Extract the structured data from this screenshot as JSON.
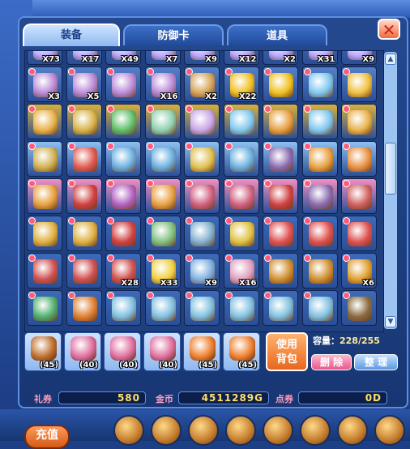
{
  "tabs": [
    {
      "label": "装备",
      "active": true
    },
    {
      "label": "防御卡",
      "active": false
    },
    {
      "label": "道具",
      "active": false
    }
  ],
  "close_icon": "close-x-icon",
  "grid_rows": [
    {
      "items": [
        {
          "color": "#b9a9ff",
          "count": "X73"
        },
        {
          "color": "#b9a9ff",
          "count": "X17"
        },
        {
          "color": "#b9a9ff",
          "count": "X49"
        },
        {
          "color": "#b9a9ff",
          "count": "X7"
        },
        {
          "color": "#b9a9ff",
          "count": "X9"
        },
        {
          "color": "#b9a9ff",
          "count": "X12"
        },
        {
          "color": "#b9a9ff",
          "count": "X2"
        },
        {
          "color": "#b9a9ff",
          "count": "X31"
        },
        {
          "color": "#b9a9ff",
          "count": "X9"
        }
      ]
    },
    {
      "items": [
        {
          "color": "#b98ad8",
          "count": "X3"
        },
        {
          "color": "#b98ad8",
          "count": "X5"
        },
        {
          "color": "#b98ad8",
          "count": ""
        },
        {
          "color": "#b98ad8",
          "count": "X16"
        },
        {
          "color": "#d6a45a",
          "count": "X2"
        },
        {
          "color": "#f0c020",
          "count": "X22"
        },
        {
          "color": "#f0c020",
          "count": ""
        },
        {
          "color": "#7ec8f0",
          "count": ""
        },
        {
          "color": "#f0c040",
          "count": ""
        }
      ]
    },
    {
      "items": [
        {
          "color": "#e8b24a",
          "count": ""
        },
        {
          "color": "#d9b34a",
          "count": ""
        },
        {
          "color": "#5fbf6a",
          "count": ""
        },
        {
          "color": "#8fd0b0",
          "count": ""
        },
        {
          "color": "#c9a6e8",
          "count": ""
        },
        {
          "color": "#7ec8f0",
          "count": ""
        },
        {
          "color": "#e8a040",
          "count": ""
        },
        {
          "color": "#7ec8f0",
          "count": ""
        },
        {
          "color": "#e8b24a",
          "count": ""
        }
      ]
    },
    {
      "items": [
        {
          "color": "#d0b050",
          "count": ""
        },
        {
          "color": "#e05a50",
          "count": ""
        },
        {
          "color": "#6ab0e0",
          "count": ""
        },
        {
          "color": "#6ab0e0",
          "count": ""
        },
        {
          "color": "#e0c050",
          "count": ""
        },
        {
          "color": "#6ab0e0",
          "count": ""
        },
        {
          "color": "#8a6ab0",
          "count": ""
        },
        {
          "color": "#e8a040",
          "count": ""
        },
        {
          "color": "#e89040",
          "count": ""
        }
      ]
    },
    {
      "items": [
        {
          "color": "#e8a040",
          "count": ""
        },
        {
          "color": "#d04040",
          "count": ""
        },
        {
          "color": "#b060c0",
          "count": ""
        },
        {
          "color": "#e8a040",
          "count": ""
        },
        {
          "color": "#d06080",
          "count": ""
        },
        {
          "color": "#d06080",
          "count": ""
        },
        {
          "color": "#d04040",
          "count": ""
        },
        {
          "color": "#8a6ab0",
          "count": ""
        },
        {
          "color": "#d06060",
          "count": ""
        }
      ]
    },
    {
      "items": [
        {
          "color": "#e0b040",
          "count": ""
        },
        {
          "color": "#e0b040",
          "count": ""
        },
        {
          "color": "#d04040",
          "count": ""
        },
        {
          "color": "#80c080",
          "count": ""
        },
        {
          "color": "#80b0d0",
          "count": ""
        },
        {
          "color": "#e0c040",
          "count": ""
        },
        {
          "color": "#e05050",
          "count": ""
        },
        {
          "color": "#e05050",
          "count": ""
        },
        {
          "color": "#e05050",
          "count": ""
        }
      ]
    },
    {
      "items": [
        {
          "color": "#d05050",
          "count": ""
        },
        {
          "color": "#d05050",
          "count": ""
        },
        {
          "color": "#d05050",
          "count": "X28"
        },
        {
          "color": "#f0d040",
          "count": "X33"
        },
        {
          "color": "#80b0e0",
          "count": "X9"
        },
        {
          "color": "#e0a0c0",
          "count": "X16"
        },
        {
          "color": "#d09030",
          "count": ""
        },
        {
          "color": "#d09030",
          "count": ""
        },
        {
          "color": "#e0a030",
          "count": "X6"
        }
      ]
    },
    {
      "items": [
        {
          "color": "#50b070",
          "count": ""
        },
        {
          "color": "#e08030",
          "count": ""
        },
        {
          "color": "#80c0e0",
          "count": ""
        },
        {
          "color": "#80c0e0",
          "count": ""
        },
        {
          "color": "#80c0e0",
          "count": ""
        },
        {
          "color": "#80c0e0",
          "count": ""
        },
        {
          "color": "#80c0e0",
          "count": ""
        },
        {
          "color": "#80c0e0",
          "count": ""
        },
        {
          "color": "#8a6a40",
          "count": ""
        }
      ]
    }
  ],
  "grid_row_tints": [
    "#4a6fb8",
    "#5580c8",
    "#d8b040",
    "#8ec0f0",
    "#f090c0",
    "#3d6ab8",
    "#3d6ab8",
    "#3d6ab8"
  ],
  "equip_slots": [
    {
      "level": "(45)",
      "color": "#c07030"
    },
    {
      "level": "(40)",
      "color": "#e070a0"
    },
    {
      "level": "(40)",
      "color": "#e070a0"
    },
    {
      "level": "(40)",
      "color": "#e070a0"
    },
    {
      "level": "(45)",
      "color": "#f08030"
    },
    {
      "level": "(45)",
      "color": "#f08030"
    }
  ],
  "use_button": {
    "line1": "使用",
    "line2": "背包"
  },
  "capacity": {
    "label": "容量：",
    "value": "228/255"
  },
  "delete_label": "删 除",
  "sort_label": "整 理",
  "currency": {
    "gift_label": "礼券",
    "gift_value": "580",
    "gold_label": "金币",
    "gold_value": "4511289G",
    "points_label": "点券",
    "points_value": "0D"
  },
  "bottom": {
    "recharge_label": "充值"
  }
}
